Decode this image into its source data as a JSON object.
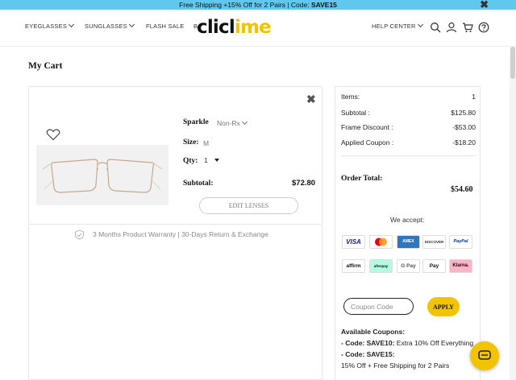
{
  "promo": {
    "text": "Free Shipping +15% Off for 2 Pairs | Code: ",
    "code": "SAVE15"
  },
  "nav": {
    "eyeglasses": "EYEGLASSES",
    "sunglasses": "SUNGLASSES",
    "flash_sale": "FLASH SALE",
    "partial": "B",
    "logo_dark": "clicl",
    "logo_yellow": "i",
    "logo_dark2": "me",
    "help_center": "HELP CENTER"
  },
  "page_title": "My Cart",
  "product": {
    "name": "Sparkle",
    "lens_type": "Non-Rx",
    "size_label": "Size:",
    "size_value": "M",
    "qty_label": "Qty:",
    "qty_value": "1",
    "subtotal_label": "Subtotal:",
    "subtotal_value": "$72.80",
    "edit_lenses": "EDIT LENSES"
  },
  "warranty": "3 Months Product Warranty | 30-Days Return & Exchange",
  "summary": {
    "items_label": "Items:",
    "items_value": "1",
    "subtotal_label": "Subtotal :",
    "subtotal_value": "$125.80",
    "frame_discount_label": "Frame Discount :",
    "frame_discount_value": "-$53.00",
    "applied_coupon_label": "Applied Coupon :",
    "applied_coupon_value": "-$18.20",
    "order_total_label": "Order Total:",
    "order_total_value": "$54.60",
    "we_accept": "We accept:"
  },
  "payments": {
    "visa": "VISA",
    "mastercard": "mastercard",
    "amex": "AMEX",
    "discover": "DISCOVER",
    "paypal": "PayPal",
    "affirm": "affirm",
    "afterpay": "afterpay",
    "gpay": "G Pay",
    "applepay": " Pay",
    "klarna": "Klarna."
  },
  "coupon": {
    "placeholder": "Coupon Code",
    "apply": "APPLY"
  },
  "available": {
    "heading": "Available Coupons:",
    "c1_prefix": " - Code: SAVE10:",
    "c1_text": " Extra 10% Off Everything",
    "c2_prefix": " - Code: SAVE15:",
    "c2_text": "15% Off + Free Shipping for 2 Pairs"
  },
  "colors": {
    "promo_bg": "#5fc8ec",
    "brand_yellow": "#f2c400"
  }
}
